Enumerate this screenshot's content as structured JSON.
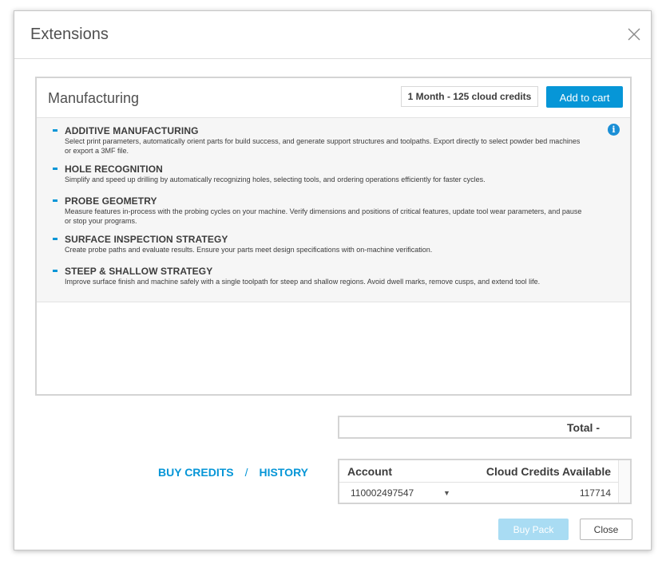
{
  "dialog": {
    "title": "Extensions"
  },
  "panel": {
    "title": "Manufacturing",
    "plan": "1 Month - 125 cloud credits",
    "add_to_cart": "Add to cart",
    "features": [
      {
        "name": "ADDITIVE MANUFACTURING",
        "description": "Select print parameters, automatically orient parts for build success, and generate support structures and toolpaths. Export directly to select powder bed machines or export a 3MF file."
      },
      {
        "name": "HOLE RECOGNITION",
        "description": "Simplify and speed up drilling by automatically recognizing holes, selecting tools, and ordering operations efficiently for faster cycles."
      },
      {
        "name": "PROBE GEOMETRY",
        "description": "Measure features in-process with the probing cycles on your machine. Verify dimensions and positions of critical features, update tool wear parameters, and pause or stop your programs."
      },
      {
        "name": "SURFACE INSPECTION STRATEGY",
        "description": "Create probe paths and evaluate results. Ensure your parts meet design specifications with on-machine verification."
      },
      {
        "name": "STEEP & SHALLOW STRATEGY",
        "description": "Improve surface finish and machine safely with a single toolpath for steep and shallow regions. Avoid dwell marks, remove cusps, and extend tool life."
      }
    ]
  },
  "total": {
    "label": "Total -"
  },
  "links": {
    "buy_credits": "BUY CREDITS",
    "separator": "/",
    "history": "HISTORY"
  },
  "account": {
    "col_account": "Account",
    "col_credits": "Cloud Credits Available",
    "selected_account": "110002497547",
    "credits": "117714"
  },
  "footer": {
    "buy_pack": "Buy Pack",
    "close": "Close"
  },
  "colors": {
    "accent": "#0696d7",
    "accent_disabled": "#a9dcf3"
  },
  "icons": {
    "close": "close-icon",
    "info": "info-icon",
    "dropdown": "triangle-down-icon"
  }
}
